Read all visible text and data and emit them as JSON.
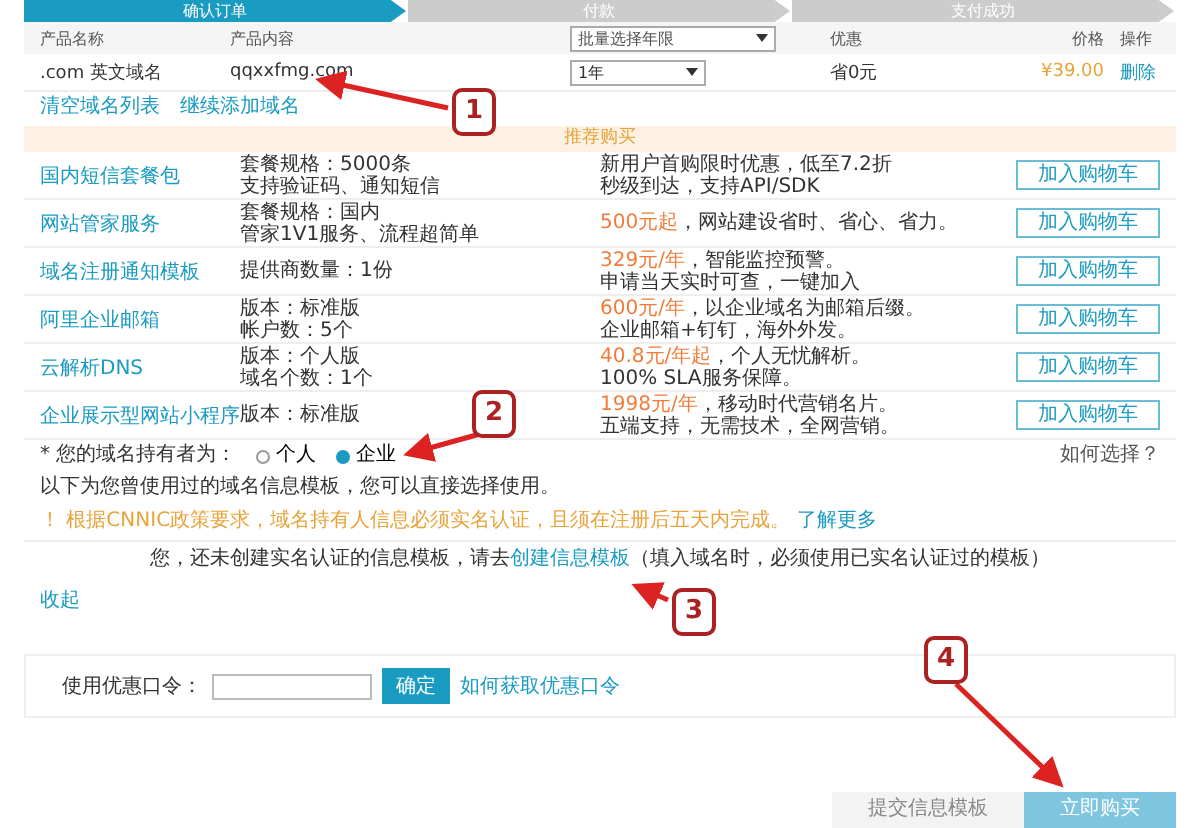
{
  "steps": [
    {
      "label": "确认订单",
      "selected": true
    },
    {
      "label": "付款",
      "selected": false
    },
    {
      "label": "支付成功",
      "selected": false
    }
  ],
  "cart": {
    "columns": [
      "产品名称",
      "产品内容",
      "批量选择年限",
      "优惠",
      "价格",
      "操作"
    ],
    "rows": [
      {
        "name": ".com 英文域名",
        "content": "qqxxfmg.com",
        "period": "1年",
        "discount": "省0元",
        "price": "¥39.00",
        "action": "删除"
      }
    ],
    "links": [
      "清空域名列表",
      "继续添加域名"
    ]
  },
  "recommend": {
    "title": "推荐购买",
    "items": [
      {
        "name": "国内短信套餐包",
        "lines": [
          "套餐规格：5000条",
          "支持验证码、通知短信"
        ],
        "desc": "新用户首购限时优惠，低至7.2折",
        "desc2": "秒级到达，支持API/SDK",
        "button": "加入购物车"
      },
      {
        "name": "网站管家服务",
        "lines": [
          "套餐规格：国内",
          "管家1V1服务、流程超简单"
        ],
        "price_note": "500元起",
        "desc": "，网站建设省时、省心、省力。",
        "button": "加入购物车"
      },
      {
        "name": "域名注册通知模板",
        "lines": [
          "提供商数量：1份"
        ],
        "price_note": "329元/年",
        "desc": "，智能监控预警。",
        "desc2": "申请当天实时可查，一键加入",
        "button": "加入购物车"
      },
      {
        "name": "阿里企业邮箱",
        "lines": [
          "版本：标准版",
          "帐户数：5个"
        ],
        "price_note": "600元/年",
        "desc": "，以企业域名为邮箱后缀。",
        "desc2": "企业邮箱+钉钉，海外外发。",
        "button": "加入购物车"
      },
      {
        "name": "云解析DNS",
        "lines": [
          "版本：个人版",
          "域名个数：1个"
        ],
        "price_note": "40.8元/年起",
        "desc": "，个人无忧解析。",
        "desc2": "100% SLA服务保障。",
        "button": "加入购物车"
      },
      {
        "name": "企业展示型网站小程序",
        "lines": [
          "版本：标准版"
        ],
        "price_note": "1998元/年",
        "desc": "，移动时代营销名片。",
        "desc2": "五端支持，无需技术，全网营销。",
        "button": "加入购物车"
      }
    ]
  },
  "owner": {
    "label": "* 您的域名持有者为：",
    "options": [
      {
        "label": "个人",
        "selected": false
      },
      {
        "label": "企业",
        "selected": true
      }
    ],
    "help": "如何选择？"
  },
  "template_note": "以下为您曾使用过的域名信息模板，您可以直接选择使用。",
  "warning": {
    "text": "！ 根据CNNIC政策要求，域名持有人信息必须实名认证，且须在注册后五天内完成。",
    "link": "了解更多"
  },
  "template_prompt": {
    "text": "您，还未创建实名认证的信息模板，请去",
    "link": "创建信息模板",
    "note": "（填入域名时，必须使用已实名认证过的模板）"
  },
  "collapse": "收起",
  "coupon": {
    "label": "使用优惠口令：",
    "button": "确定",
    "link": "如何获取优惠口令"
  },
  "footer_buttons": [
    {
      "label": "提交信息模板",
      "kind": "secondary"
    },
    {
      "label": "立即购买",
      "kind": "primary"
    }
  ],
  "annotations": [
    {
      "number": "1"
    },
    {
      "number": "2"
    },
    {
      "number": "3"
    },
    {
      "number": "4"
    }
  ]
}
